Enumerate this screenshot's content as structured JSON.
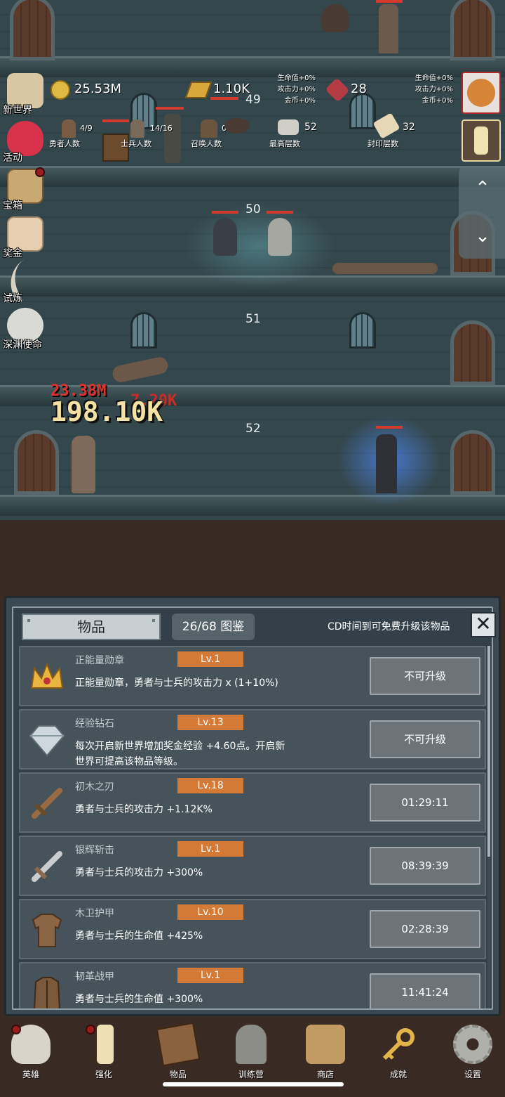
{
  "resources": {
    "gold": "25.53M",
    "gold_bars": "1.10K",
    "gems": "28",
    "bonus_1": [
      "生命值+0%",
      "攻击力+0%",
      "金币+0%"
    ],
    "bonus_2": [
      "生命值+0%",
      "攻击力+0%",
      "金币+0%"
    ]
  },
  "counters": [
    {
      "value": "4/9",
      "label": "勇者人数"
    },
    {
      "value": "14/16",
      "label": "士兵人数"
    },
    {
      "value": "0",
      "label": "召唤人数"
    },
    {
      "value": "52",
      "label": "最高层数"
    },
    {
      "value": "32",
      "label": "封印层数"
    }
  ],
  "side_menu": [
    "新世界",
    "活动",
    "宝箱",
    "奖金",
    "试炼",
    "深渊使命"
  ],
  "floors": [
    "49",
    "50",
    "51",
    "52"
  ],
  "damage": {
    "big": "198.10K",
    "small": "23.38M",
    "back": "7.20K"
  },
  "panel": {
    "title": "物品",
    "count": "26/68 图鉴",
    "hint": "CD时间到可免费升级该物品"
  },
  "items": [
    {
      "name": "正能量勋章",
      "level": "Lv.1",
      "desc": "正能量勋章，勇者与士兵的攻击力 x (1+10%)",
      "action": "不可升级",
      "icon": "crown-icon"
    },
    {
      "name": "经验钻石",
      "level": "Lv.13",
      "desc": "每次开启新世界增加奖金经验 +4.60点。开启新世界可提高该物品等级。",
      "action": "不可升级",
      "icon": "diamond-icon"
    },
    {
      "name": "初木之刃",
      "level": "Lv.18",
      "desc": "勇者与士兵的攻击力 +1.12K%",
      "action": "01:29:11",
      "icon": "wooden-sword-icon"
    },
    {
      "name": "银辉斩击",
      "level": "Lv.1",
      "desc": "勇者与士兵的攻击力 +300%",
      "action": "08:39:39",
      "icon": "silver-sword-icon"
    },
    {
      "name": "木卫护甲",
      "level": "Lv.10",
      "desc": "勇者与士兵的生命值 +425%",
      "action": "02:28:39",
      "icon": "wooden-armor-icon"
    },
    {
      "name": "韧革战甲",
      "level": "Lv.1",
      "desc": "勇者与士兵的生命值 +300%",
      "action": "11:41:24",
      "icon": "leather-armor-icon"
    }
  ],
  "nav": [
    "英雄",
    "强化",
    "物品",
    "训练营",
    "商店",
    "成就",
    "设置"
  ],
  "colors": {
    "level_badge": "#d57a36",
    "hp_bar": "#d33a2c",
    "panel_bg": "#334049"
  }
}
